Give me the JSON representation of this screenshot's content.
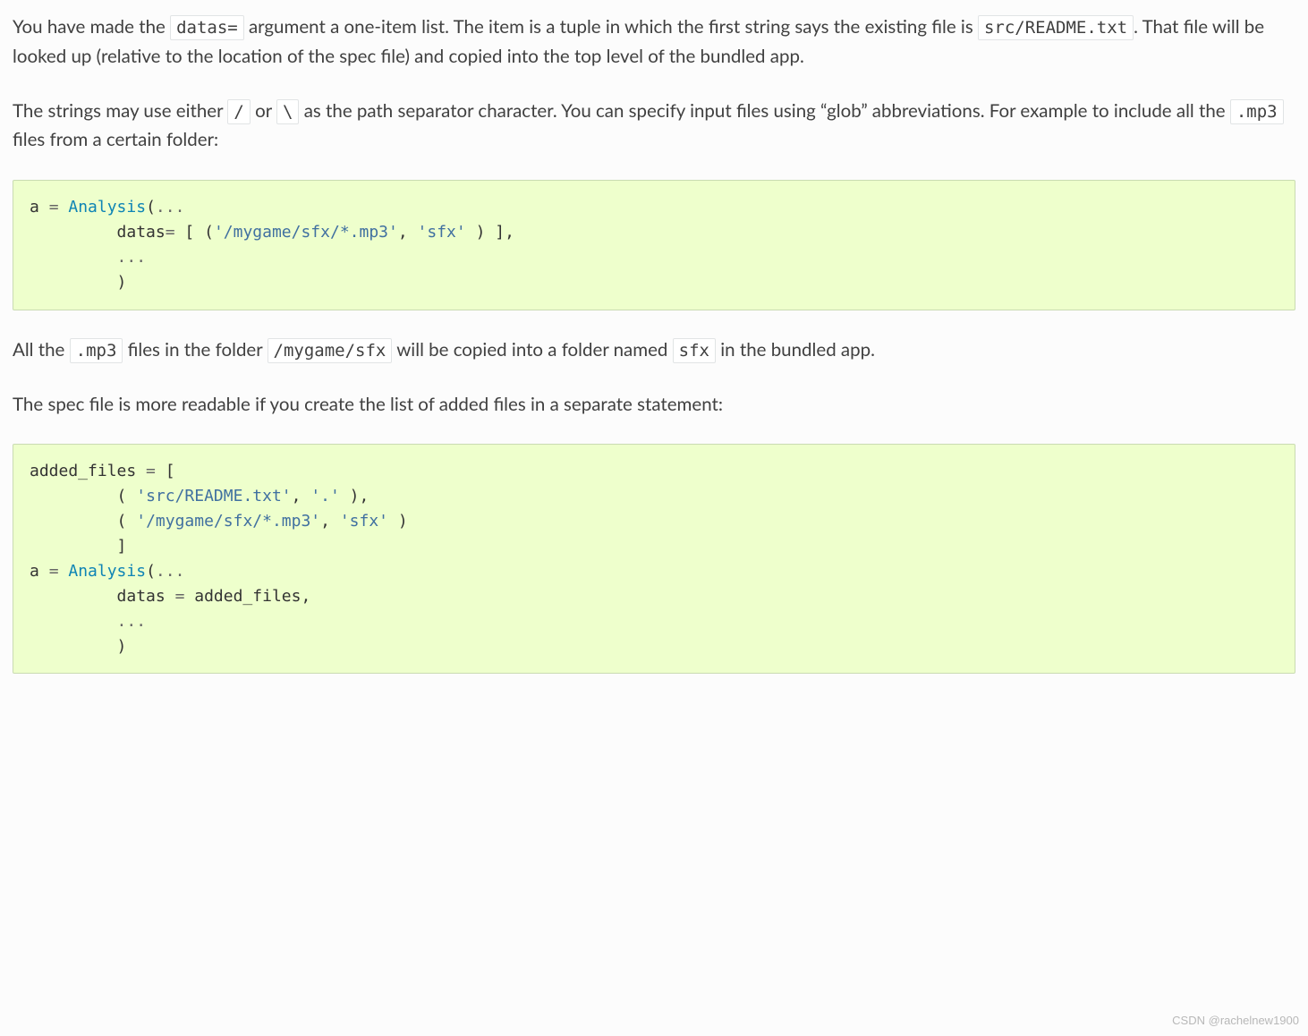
{
  "para1": {
    "t1": "You have made the ",
    "c1": "datas=",
    "t2": " argument a one-item list. The item is a tuple in which the first string says the existing file is ",
    "c2": "src/README.txt",
    "t3": ". That file will be looked up (relative to the location of the spec file) and copied into the top level of the bundled app."
  },
  "para2": {
    "t1": "The strings may use either ",
    "c1": "/",
    "t2": " or ",
    "c2": "\\",
    "t3": " as the path separator character. You can specify input files using “glob” abbreviations. For example to include all the ",
    "c3": ".mp3",
    "t4": " files from a certain folder:"
  },
  "code1": {
    "l1a": "a ",
    "l1b": "=",
    "l1c": " Analysis",
    "l1d": "(",
    "l1e": "...",
    "l2a": "         datas",
    "l2b": "=",
    "l2c": " ",
    "l2d": "[",
    "l2e": " ",
    "l2f": "(",
    "l2g": "'/mygame/sfx/*.mp3'",
    "l2h": ",",
    "l2i": " ",
    "l2j": "'sfx'",
    "l2k": " ",
    "l2l": ")",
    "l2m": " ",
    "l2n": "]",
    "l2o": ",",
    "l3a": "         ",
    "l3b": "...",
    "l4a": "         ",
    "l4b": ")"
  },
  "para3": {
    "t1": "All the ",
    "c1": ".mp3",
    "t2": " files in the folder ",
    "c2": "/mygame/sfx",
    "t3": " will be copied into a folder named ",
    "c3": "sfx",
    "t4": " in the bundled app."
  },
  "para4": {
    "t1": "The spec file is more readable if you create the list of added files in a separate statement:"
  },
  "code2": {
    "l1a": "added_files ",
    "l1b": "=",
    "l1c": " ",
    "l1d": "[",
    "l2a": "         ",
    "l2b": "(",
    "l2c": " ",
    "l2d": "'src/README.txt'",
    "l2e": ",",
    "l2f": " ",
    "l2g": "'.'",
    "l2h": " ",
    "l2i": ")",
    "l2j": ",",
    "l3a": "         ",
    "l3b": "(",
    "l3c": " ",
    "l3d": "'/mygame/sfx/*.mp3'",
    "l3e": ",",
    "l3f": " ",
    "l3g": "'sfx'",
    "l3h": " ",
    "l3i": ")",
    "l4a": "         ",
    "l4b": "]",
    "l5a": "a ",
    "l5b": "=",
    "l5c": " Analysis",
    "l5d": "(",
    "l5e": "...",
    "l6a": "         datas ",
    "l6b": "=",
    "l6c": " added_files",
    "l6d": ",",
    "l7a": "         ",
    "l7b": "...",
    "l8a": "         ",
    "l8b": ")"
  },
  "watermark": "CSDN @rachelnew1900"
}
